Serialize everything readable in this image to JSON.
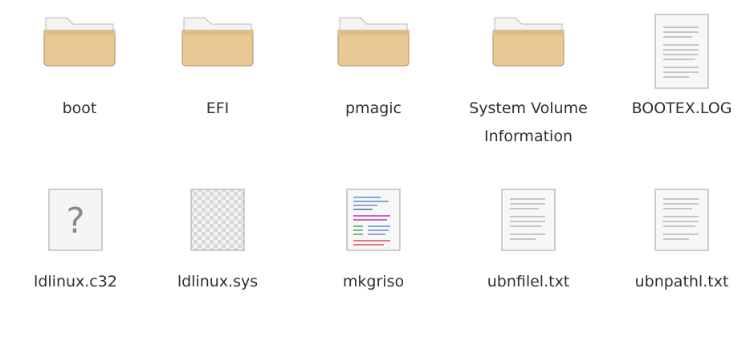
{
  "files": [
    {
      "name": "boot",
      "icon": "folder-icon"
    },
    {
      "name": "EFI",
      "icon": "folder-icon"
    },
    {
      "name": "pmagic",
      "icon": "folder-icon"
    },
    {
      "name": "System Volume Information",
      "icon": "folder-icon"
    },
    {
      "name": "BOOTEX.LOG",
      "icon": "text-document-icon"
    },
    {
      "name": "ldlinux.c32",
      "icon": "unknown-file-icon"
    },
    {
      "name": "ldlinux.sys",
      "icon": "transparent-file-icon"
    },
    {
      "name": "mkgriso",
      "icon": "script-file-icon"
    },
    {
      "name": "ubnfilel.txt",
      "icon": "text-document-icon"
    },
    {
      "name": "ubnpathl.txt",
      "icon": "text-document-icon"
    }
  ],
  "colors": {
    "folder_body": "#e8c894",
    "folder_tab": "#f4f4f4",
    "folder_edge": "#b08a5a",
    "doc_page": "#f7f7f7",
    "doc_lines": "#c8c8c8",
    "text": "#2e2e2e"
  }
}
